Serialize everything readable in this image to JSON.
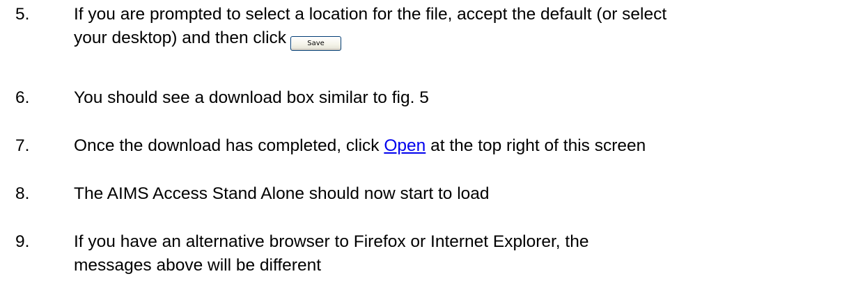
{
  "steps": [
    {
      "number": "5.",
      "line1": "If you are prompted to select a location for the file, accept the default (or select",
      "line2": "your desktop) and then click",
      "button_label": "Save"
    },
    {
      "number": "6.",
      "text": "You should see a download box similar to fig. 5"
    },
    {
      "number": "7.",
      "before_link": "Once the download has completed, click ",
      "link_text": "Open",
      "after_link": " at the top right of this screen"
    },
    {
      "number": "8.",
      "text": "The AIMS Access Stand Alone should now start to load"
    },
    {
      "number": "9.",
      "line1": "If you have an alternative browser to Firefox or Internet Explorer, the",
      "line2": "messages above will be different"
    }
  ],
  "colors": {
    "link": "#0000ee",
    "button_border": "#003c74"
  }
}
